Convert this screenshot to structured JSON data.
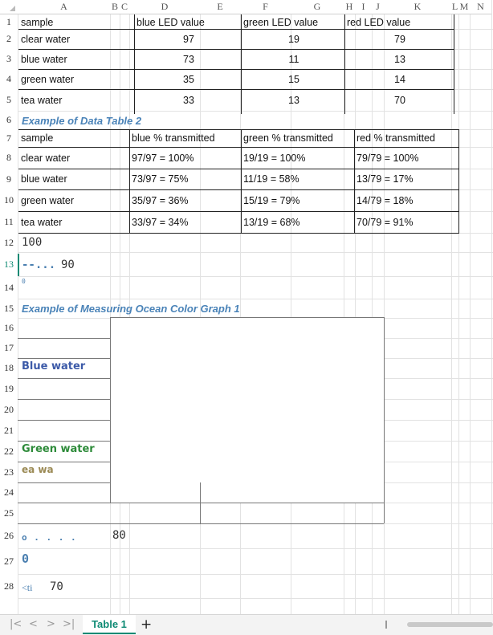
{
  "columns": [
    "A",
    "B",
    "C",
    "D",
    "E",
    "F",
    "G",
    "H",
    "I",
    "J",
    "K",
    "L",
    "M",
    "N"
  ],
  "rows": [
    "1",
    "2",
    "3",
    "4",
    "5",
    "6",
    "7",
    "8",
    "9",
    "10",
    "11",
    "12",
    "13",
    "14",
    "15",
    "16",
    "17",
    "18",
    "19",
    "20",
    "21",
    "22",
    "23",
    "24",
    "25",
    "26",
    "27",
    "28"
  ],
  "table1": {
    "headers": [
      "sample",
      "blue LED value",
      "green LED value",
      "red LED value"
    ],
    "rows": [
      [
        "clear water",
        "97",
        "19",
        "79"
      ],
      [
        "blue water",
        "73",
        "11",
        "13"
      ],
      [
        "green water",
        "35",
        "15",
        "14"
      ],
      [
        "tea water",
        "33",
        "13",
        "70"
      ]
    ]
  },
  "table2": {
    "title": "Example of Data Table 2",
    "headers": [
      "sample",
      "blue % transmitted",
      "green % transmitted",
      "red % transmitted"
    ],
    "rows": [
      [
        "clear water",
        "97/97 = 100%",
        "19/19 = 100%",
        "79/79 = 100%"
      ],
      [
        "blue water",
        "73/97 = 75%",
        "11/19 = 58%",
        "13/79 = 17%"
      ],
      [
        "green water",
        "35/97 = 36%",
        "15/19 = 79%",
        "14/79 = 18%"
      ],
      [
        "tea water",
        "33/97 = 34%",
        "13/19 = 68%",
        "70/79 = 91%"
      ]
    ]
  },
  "fragments": {
    "r12": "100",
    "r13_dash": "--...",
    "r13_val": "90",
    "r14": "0",
    "r26_dots": "o . . . .",
    "r26_val": "80",
    "r27": "0",
    "r28_a": "<ti",
    "r28_b": "70"
  },
  "graph": {
    "title": "Example of Measuring Ocean Color Graph 1",
    "legend_blue": "Blue water",
    "legend_green": "Green water",
    "legend_tea": "ea wa",
    "colors": {
      "blue": "#3c5aa8",
      "green": "#2e8b3a",
      "tea": "#9b8a55",
      "heading": "#4a83b8"
    }
  },
  "tabs": {
    "sheet1": "Table 1",
    "add": "+"
  },
  "nav": {
    "first": "|<",
    "prev": "<",
    "next": ">",
    "last": ">|"
  }
}
